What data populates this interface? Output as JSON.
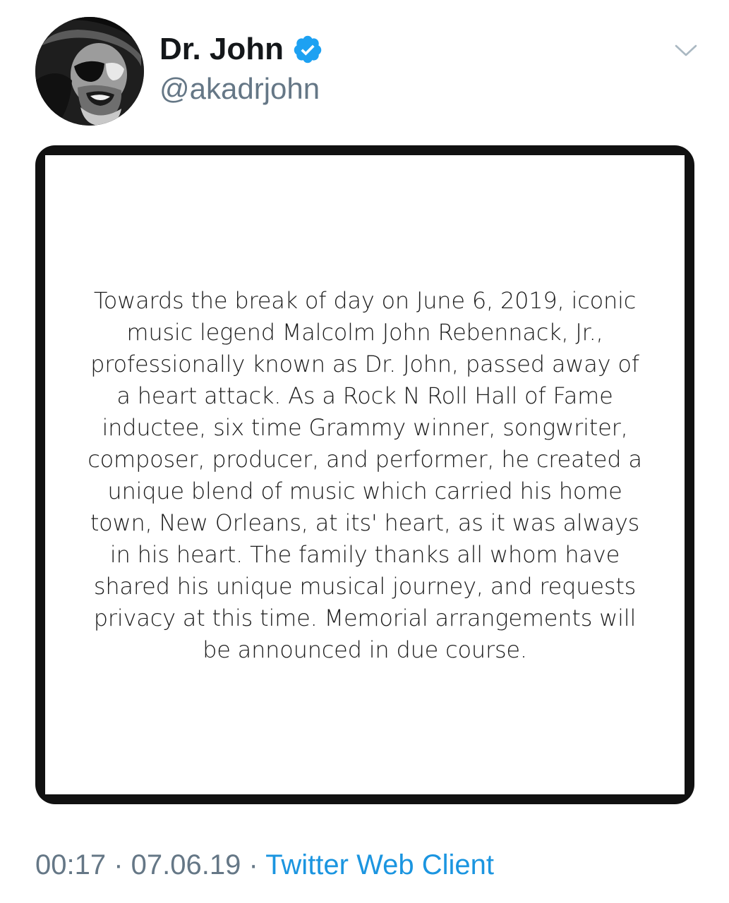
{
  "tweet": {
    "author": {
      "display_name": "Dr. John",
      "handle": "@akadrjohn",
      "verified": true,
      "avatar": "avatar-photo"
    },
    "menu_icon": "chevron-down-icon",
    "media": {
      "text": "Towards the break of day on June 6, 2019, iconic music legend Malcolm John Rebennack, Jr., professionally known as Dr. John, passed away of a heart attack. As a Rock N Roll Hall of Fame inductee, six time Grammy winner, songwriter, composer, producer, and performer, he created a unique blend of music which carried his home town, New Orleans, at its' heart, as it was always in his heart. The family thanks all whom have shared his unique musical journey, and requests privacy at this time. Memorial arrangements will be announced in due course."
    },
    "meta": {
      "time": "00:17",
      "separator": " · ",
      "date": "07.06.19",
      "client": "Twitter Web Client"
    }
  },
  "colors": {
    "accent": "#1b95e0",
    "verified_badge": "#1da1f2",
    "secondary_text": "#657786",
    "primary_text": "#14171a"
  }
}
